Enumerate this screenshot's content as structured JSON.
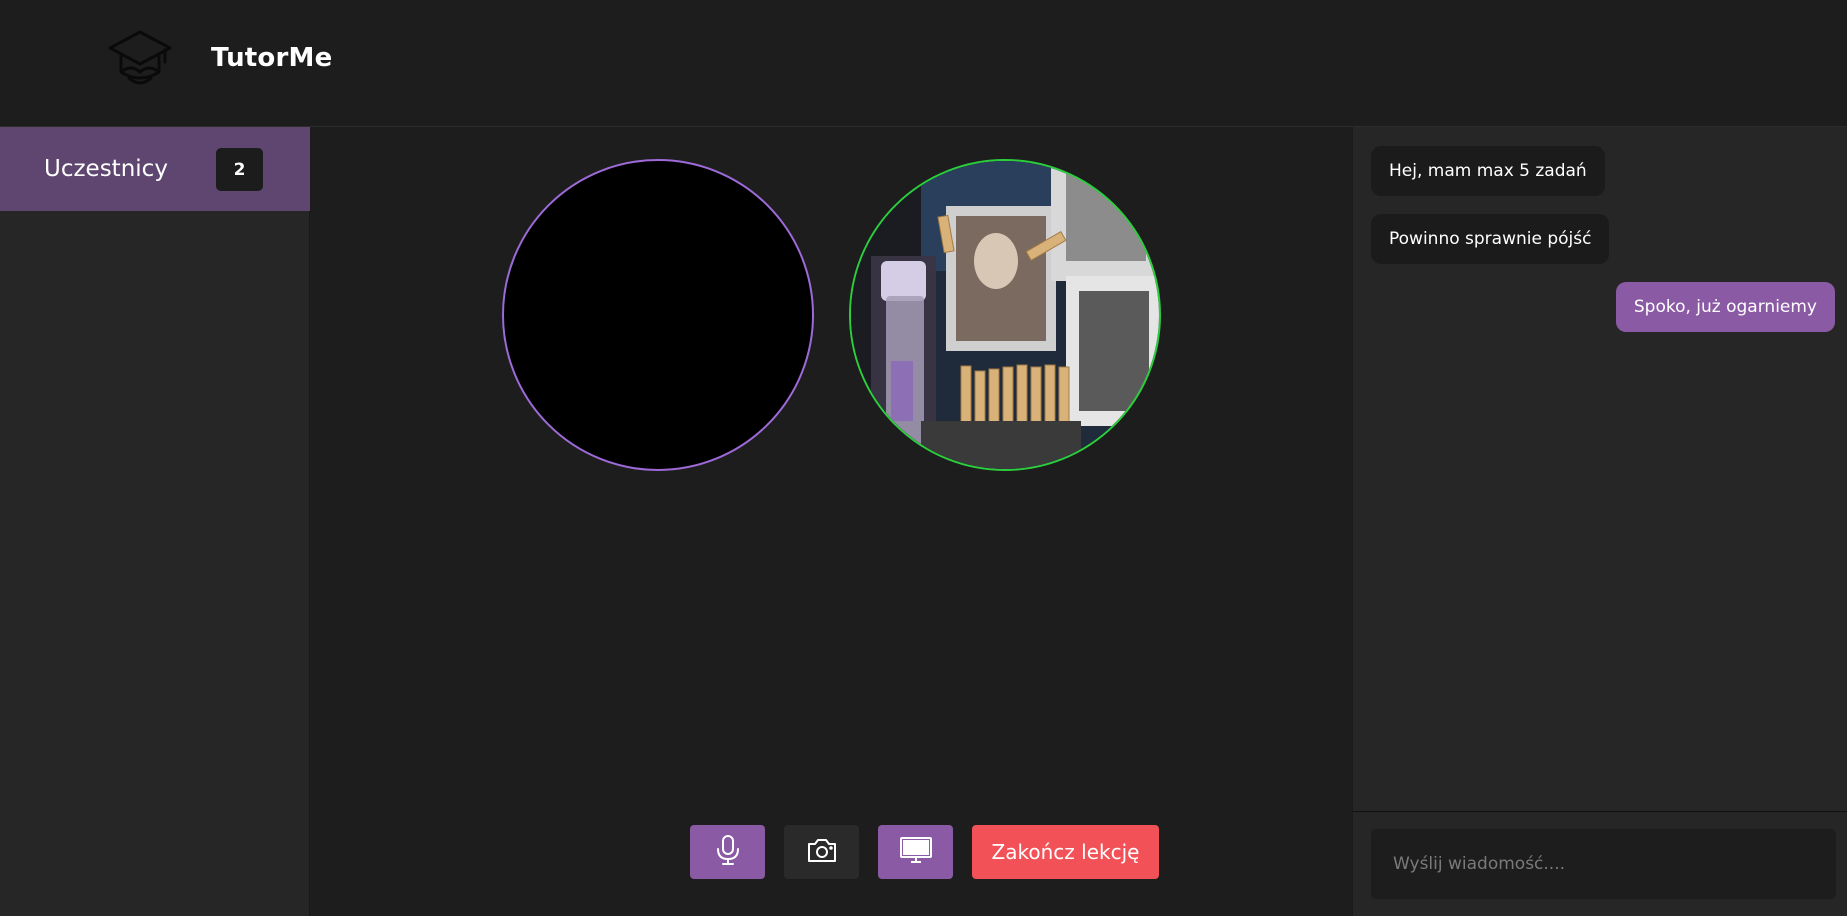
{
  "header": {
    "brand": "TutorMe",
    "logo_icon": "graduation-cap-icon"
  },
  "sidebar": {
    "participants_label": "Uczestnicy",
    "participants_count": "2",
    "accent_color": "#5f4670"
  },
  "video": {
    "self_border_color": "#9d6ad8",
    "remote_border_color": "#2bcf3c"
  },
  "controls": {
    "mic_icon": "microphone-icon",
    "camera_icon": "camera-icon",
    "screen_icon": "monitor-icon",
    "end_label": "Zakończ lekcję",
    "end_color": "#f25157",
    "accent_color": "#8a5aa5"
  },
  "chat": {
    "messages": [
      {
        "text": "Hej, mam max 5 zadań",
        "direction": "incoming"
      },
      {
        "text": "Powinno sprawnie pójść",
        "direction": "incoming"
      },
      {
        "text": "Spoko, już ogarniemy",
        "direction": "outgoing"
      }
    ],
    "input_placeholder": "Wyślij wiadomość...."
  }
}
